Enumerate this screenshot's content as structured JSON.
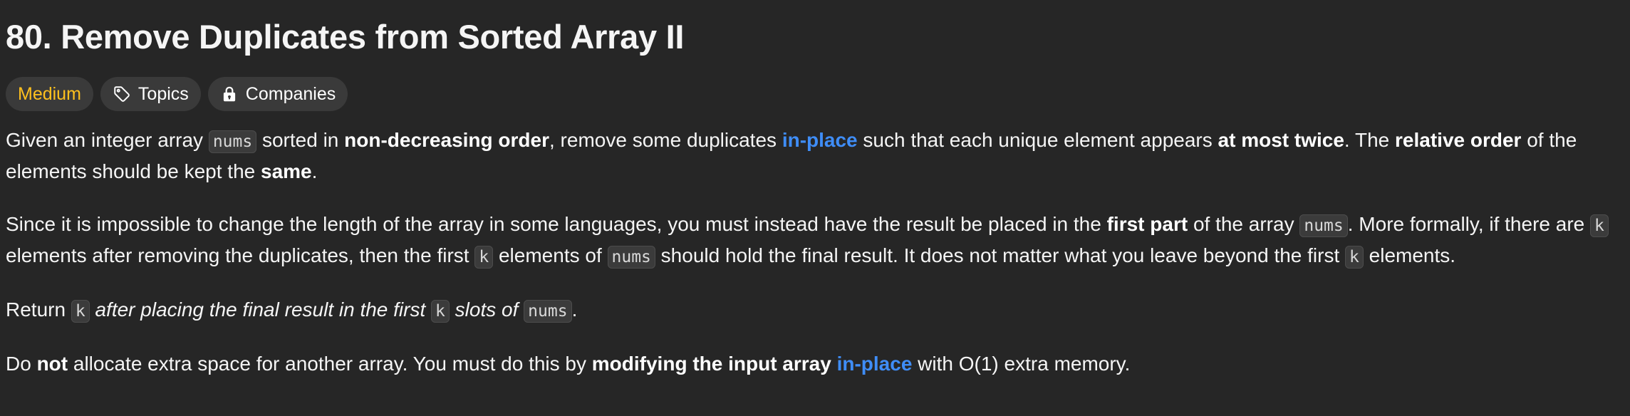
{
  "problem": {
    "title": "80. Remove Duplicates from Sorted Array II",
    "difficulty": "Medium",
    "tags": {
      "topics_label": "Topics",
      "companies_label": "Companies"
    }
  },
  "description": {
    "p1": {
      "t1": "Given an integer array ",
      "code1": "nums",
      "t2": " sorted in ",
      "b1": "non-decreasing order",
      "t3": ", remove some duplicates ",
      "link1": "in-place",
      "t4": " such that each unique element appears ",
      "b2": "at most twice",
      "t5": ". The ",
      "b3": "relative order",
      "t6": " of the elements should be kept the ",
      "b4": "same",
      "t7": "."
    },
    "p2": {
      "t1": "Since it is impossible to change the length of the array in some languages, you must instead have the result be placed in the ",
      "b1": "first part",
      "t2": " of the array ",
      "code1": "nums",
      "t3": ". More formally, if there are ",
      "code2": "k",
      "t4": " elements after removing the duplicates, then the first ",
      "code3": "k",
      "t5": " elements of ",
      "code4": "nums",
      "t6": " should hold the final result. It does not matter what you leave beyond the first ",
      "code5": "k",
      "t7": " elements."
    },
    "p3": {
      "t1": "Return ",
      "code1": "k",
      "i1": " after placing the final result in the first ",
      "code2": "k",
      "i2": " slots of ",
      "code3": "nums",
      "t2": "."
    },
    "p4": {
      "t1": "Do ",
      "b1": "not",
      "t2": " allocate extra space for another array. You must do this by ",
      "b2": "modifying the input array",
      "t3": " ",
      "link1": "in-place",
      "t4": " with O(1) extra memory."
    }
  },
  "colors": {
    "background": "#262626",
    "difficulty_medium": "#ffc01e",
    "link": "#3f8df7",
    "tag_background": "#3a3a3a"
  },
  "icons": {
    "topics": "tag-icon",
    "companies": "lock-icon"
  }
}
